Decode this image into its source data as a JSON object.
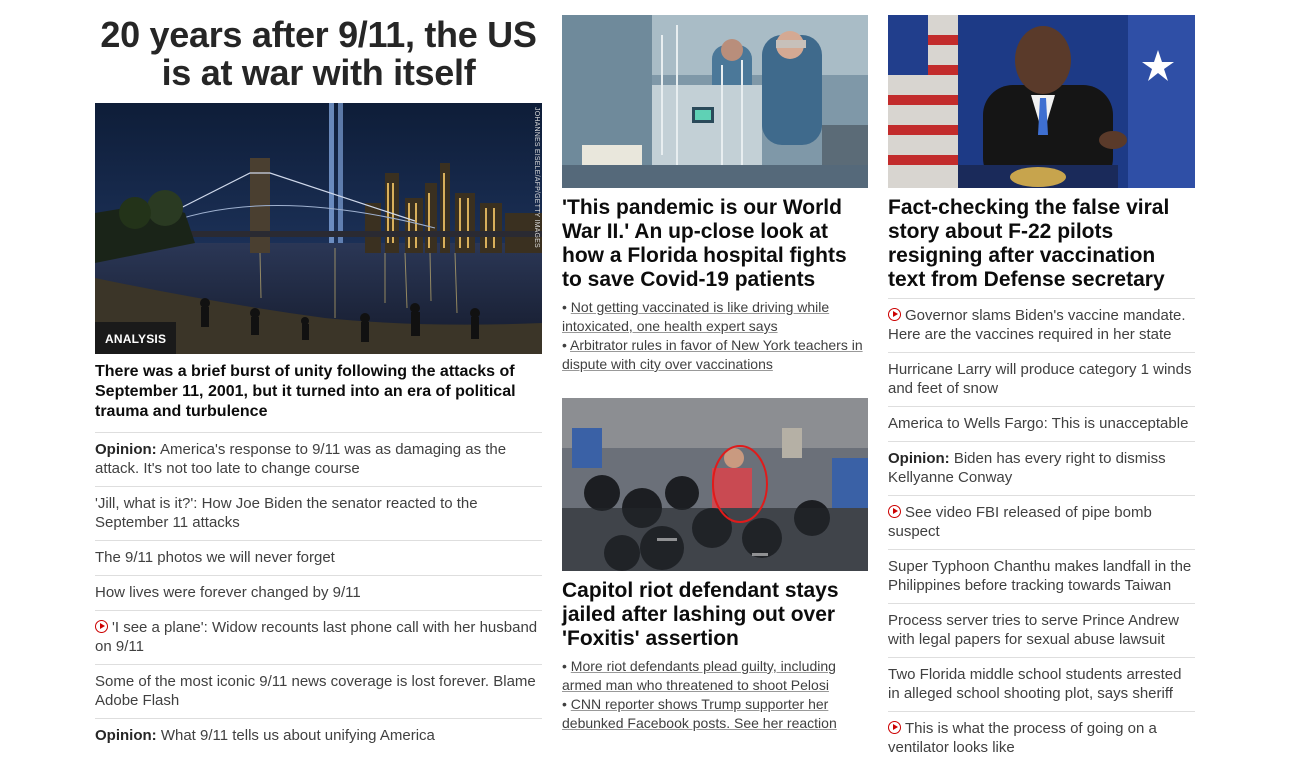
{
  "col1": {
    "headline": "20 years after 9/11, the US is at war with itself",
    "image": {
      "badge": "ANALYSIS",
      "credit": "JOHANNES EISELE/AFP/GETTY IMAGES"
    },
    "lead": "There was a brief burst of unity following the attacks of September 11, 2001, but it turned into an era of political trauma and turbulence",
    "items": [
      {
        "prefix": "Opinion:",
        "text": "America's response to 9/11 was as damaging as the attack. It's not too late to change course"
      },
      {
        "text": "'Jill, what is it?': How Joe Biden the senator reacted to the September 11 attacks"
      },
      {
        "text": "The 9/11 photos we will never forget"
      },
      {
        "text": "How lives were forever changed by 9/11"
      },
      {
        "video": true,
        "text": "'I see a plane': Widow recounts last phone call with her husband on 9/11"
      },
      {
        "text": "Some of the most iconic 9/11 news coverage is lost forever. Blame Adobe Flash"
      },
      {
        "prefix": "Opinion:",
        "text": "What 9/11 tells us about unifying America"
      }
    ]
  },
  "col2": {
    "story1": {
      "title": "'This pandemic is our World War II.' An up-close look at how a Florida hospital fights to save Covid-19 patients",
      "bullets": [
        "Not getting vaccinated is like driving while intoxicated, one health expert says",
        "Arbitrator rules in favor of New York teachers in dispute with city over vaccinations"
      ]
    },
    "story2": {
      "title": "Capitol riot defendant stays jailed after lashing out over 'Foxitis' assertion",
      "bullets": [
        "More riot defendants plead guilty, including armed man who threatened to shoot Pelosi",
        "CNN reporter shows Trump supporter her debunked Facebook posts. See her reaction"
      ]
    }
  },
  "col3": {
    "title": "Fact-checking the false viral story about F-22 pilots resigning after vaccination text from Defense secretary",
    "items": [
      {
        "video": true,
        "text": "Governor slams Biden's vaccine mandate. Here are the vaccines required in her state"
      },
      {
        "text": "Hurricane Larry will produce category 1 winds and feet of snow"
      },
      {
        "text": "America to Wells Fargo: This is unacceptable"
      },
      {
        "prefix": "Opinion:",
        "text": "Biden has every right to dismiss Kellyanne Conway"
      },
      {
        "video": true,
        "text": "See video FBI released of pipe bomb suspect"
      },
      {
        "text": "Super Typhoon Chanthu makes landfall in the Philippines before tracking towards Taiwan"
      },
      {
        "text": "Process server tries to serve Prince Andrew with legal papers for sexual abuse lawsuit"
      },
      {
        "text": "Two Florida middle school students arrested in alleged school shooting plot, says sheriff"
      },
      {
        "video": true,
        "text": "This is what the process of going on a ventilator looks like"
      }
    ]
  },
  "colors": {
    "video_red": "#cc0000",
    "text": "#262626",
    "divider": "#dedede"
  },
  "icons": {
    "video": "play-circle-icon"
  }
}
